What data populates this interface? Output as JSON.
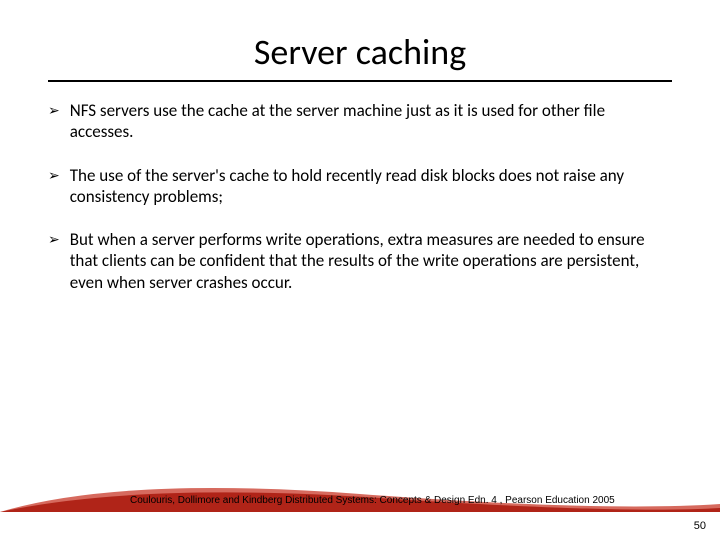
{
  "title": "Server caching",
  "bullets": [
    "NFS servers use the cache at the server machine just as it is used for other file accesses.",
    "The use of the server's cache to hold recently read disk blocks does not raise any consistency problems;",
    "But when a server performs write operations, extra measures are needed to ensure that clients can be confident that the results of the write operations are persistent, even when server crashes occur."
  ],
  "citation": "Coulouris, Dollimore and Kindberg  Distributed Systems: Concepts & Design  Edn. 4 , Pearson Education 2005",
  "page_number": "50",
  "colors": {
    "accent_red": "#b02418",
    "accent_red_light": "#d66a5e"
  }
}
